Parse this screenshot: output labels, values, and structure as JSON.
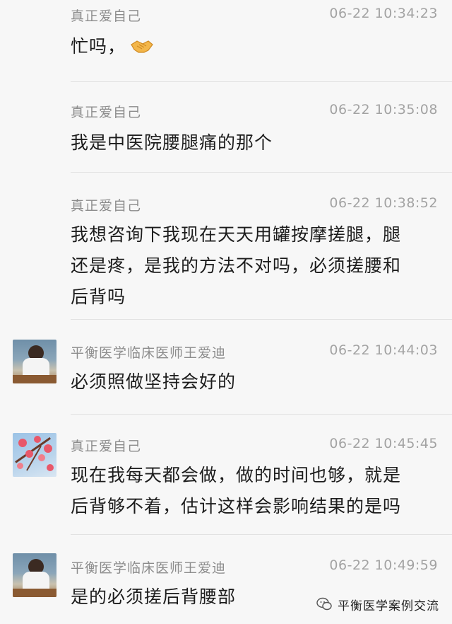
{
  "messages": [
    {
      "sender": "真正爱自己",
      "time": "06-22 10:34:23",
      "text": "忙吗，",
      "emoji": "handshake-emoji"
    },
    {
      "sender": "真正爱自己",
      "time": "06-22 10:35:08",
      "text": "我是中医院腰腿痛的那个"
    },
    {
      "sender": "真正爱自己",
      "time": "06-22 10:38:52",
      "lines": [
        "我想咨询下我现在天天用罐按摩搓腿，腿",
        "还是疼，是我的方法不对吗，必须搓腰和",
        "后背吗"
      ]
    },
    {
      "sender": "平衡医学临床医师王爱迪",
      "time": "06-22 10:44:03",
      "text": "必须照做坚持会好的",
      "avatar": "doctor-avatar"
    },
    {
      "sender": "真正爱自己",
      "time": "06-22 10:45:45",
      "lines": [
        "现在我每天都会做，做的时间也够，就是",
        "后背够不着，估计这样会影响结果的是吗"
      ],
      "avatar": "flower-avatar"
    },
    {
      "sender": "平衡医学临床医师王爱迪",
      "time": "06-22 10:49:59",
      "text": "是的必须搓后背腰部",
      "avatar": "doctor-avatar"
    }
  ],
  "watermark": {
    "text": "平衡医学案例交流",
    "icon": "wechat-icon"
  }
}
